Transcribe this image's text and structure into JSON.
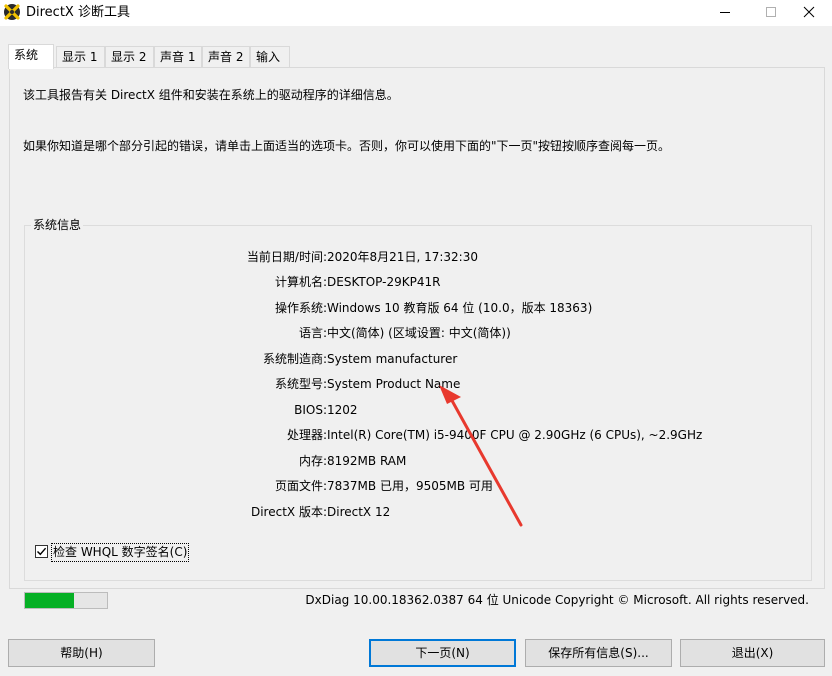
{
  "window": {
    "title": "DirectX 诊断工具"
  },
  "tabs": [
    {
      "label": "系统",
      "active": true
    },
    {
      "label": "显示 1",
      "active": false
    },
    {
      "label": "显示 2",
      "active": false
    },
    {
      "label": "声音 1",
      "active": false
    },
    {
      "label": "声音 2",
      "active": false
    },
    {
      "label": "输入",
      "active": false
    }
  ],
  "intro": {
    "line1": "该工具报告有关 DirectX 组件和安装在系统上的驱动程序的详细信息。",
    "line2": "如果你知道是哪个部分引起的错误，请单击上面适当的选项卡。否则，你可以使用下面的\"下一页\"按钮按顺序查阅每一页。"
  },
  "system_info": {
    "group_title": "系统信息",
    "rows": [
      {
        "label": "当前日期/时间:",
        "value": "2020年8月21日, 17:32:30"
      },
      {
        "label": "计算机名:",
        "value": "DESKTOP-29KP41R"
      },
      {
        "label": "操作系统:",
        "value": "Windows 10 教育版 64 位 (10.0，版本 18363)"
      },
      {
        "label": "语言:",
        "value": "中文(简体) (区域设置: 中文(简体))"
      },
      {
        "label": "系统制造商:",
        "value": "System manufacturer"
      },
      {
        "label": "系统型号:",
        "value": "System Product Name"
      },
      {
        "label": "BIOS:",
        "value": "1202"
      },
      {
        "label": "处理器:",
        "value": "Intel(R) Core(TM) i5-9400F CPU @ 2.90GHz (6 CPUs), ~2.9GHz"
      },
      {
        "label": "内存:",
        "value": "8192MB RAM"
      },
      {
        "label": "页面文件:",
        "value": "7837MB 已用，9505MB 可用"
      },
      {
        "label": "DirectX 版本:",
        "value": "DirectX 12"
      }
    ]
  },
  "whql_check": {
    "label": "检查 WHQL 数字签名(C)",
    "checked": true
  },
  "progress": {
    "fraction": 0.6,
    "color": "#06b025"
  },
  "status": {
    "text": "DxDiag 10.00.18362.0387 64 位 Unicode  Copyright © Microsoft. All rights reserved."
  },
  "buttons": {
    "help": "帮助(H)",
    "next": "下一页(N)",
    "save_all": "保存所有信息(S)...",
    "exit": "退出(X)"
  },
  "colors": {
    "accent": "#0078d7",
    "annotation_arrow": "#e8392e"
  }
}
